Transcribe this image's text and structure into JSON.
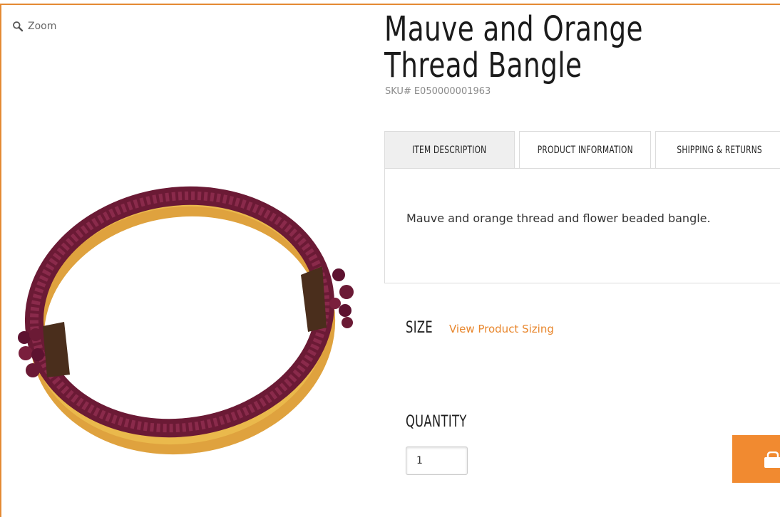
{
  "zoom": {
    "label": "Zoom",
    "icon": "magnifier-icon"
  },
  "product": {
    "title": "Mauve and Orange Thread Bangle",
    "sku_prefix": "SKU#",
    "sku": "E050000001963",
    "image_alt": "Mauve and orange thread and flower beaded bangle"
  },
  "tabs": [
    {
      "label": "ITEM DESCRIPTION",
      "active": true
    },
    {
      "label": "PRODUCT INFORMATION",
      "active": false
    },
    {
      "label": "SHIPPING & RETURNS",
      "active": false
    }
  ],
  "description": "Mauve and orange thread and flower beaded bangle.",
  "size": {
    "label": "SIZE",
    "link": "View Product Sizing"
  },
  "quantity": {
    "label": "QUANTITY",
    "value": "1"
  },
  "cart_button": {
    "icon": "shopping-bag-icon"
  },
  "colors": {
    "accent": "#f18a30",
    "border": "#e48a33",
    "link": "#e8862c",
    "mauve": "#7a1f3d",
    "gold": "#e8b347",
    "brown": "#4a2e1c"
  }
}
